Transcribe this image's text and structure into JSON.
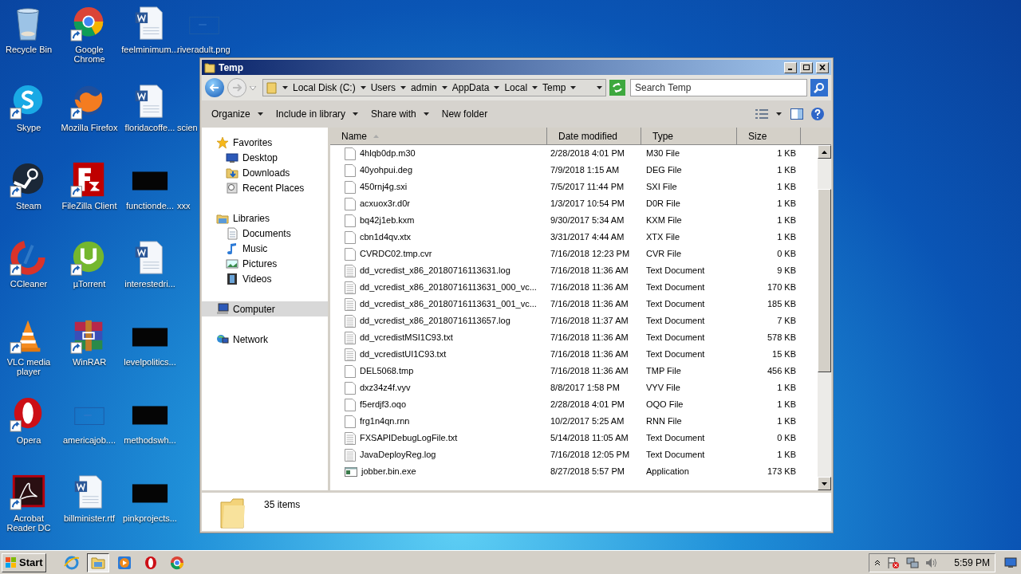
{
  "desktop": {
    "columns": [
      [
        {
          "label": "Recycle Bin",
          "kind": "recycle",
          "shortcut": false
        },
        {
          "label": "Skype",
          "kind": "skype",
          "shortcut": true
        },
        {
          "label": "Steam",
          "kind": "steam",
          "shortcut": true
        },
        {
          "label": "CCleaner",
          "kind": "ccleaner",
          "shortcut": true
        },
        {
          "label": "VLC media player",
          "kind": "vlc",
          "shortcut": true
        },
        {
          "label": "Opera",
          "kind": "opera",
          "shortcut": true
        },
        {
          "label": "Acrobat Reader DC",
          "kind": "acrobat",
          "shortcut": true
        }
      ],
      [
        {
          "label": "Google Chrome",
          "kind": "chrome",
          "shortcut": true
        },
        {
          "label": "Mozilla Firefox",
          "kind": "firefox",
          "shortcut": true
        },
        {
          "label": "FileZilla Client",
          "kind": "filezilla",
          "shortcut": true
        },
        {
          "label": "µTorrent",
          "kind": "utorrent",
          "shortcut": true
        },
        {
          "label": "WinRAR",
          "kind": "winrar",
          "shortcut": true
        },
        {
          "label": "americajob....",
          "kind": "blank-image",
          "shortcut": false
        },
        {
          "label": "billminister.rtf",
          "kind": "word",
          "shortcut": false
        }
      ],
      [
        {
          "label": "feelminimum...",
          "kind": "word",
          "shortcut": false
        },
        {
          "label": "floridacoffe...",
          "kind": "word",
          "shortcut": false
        },
        {
          "label": "functionde...",
          "kind": "dark-thumbnail",
          "shortcut": false
        },
        {
          "label": "interestedri...",
          "kind": "word",
          "shortcut": false
        },
        {
          "label": "levelpolitics...",
          "kind": "dark-thumbnail",
          "shortcut": false
        },
        {
          "label": "methodswh...",
          "kind": "dark-thumbnail",
          "shortcut": false
        },
        {
          "label": "pinkprojects...",
          "kind": "dark-thumbnail",
          "shortcut": false
        }
      ],
      [
        {
          "label": "riveradult.png",
          "kind": "blank-image",
          "shortcut": false
        },
        {
          "label": "scien"
        },
        {
          "label": "xxx"
        }
      ]
    ]
  },
  "window": {
    "title": "Temp",
    "breadcrumb": [
      "Local Disk (C:)",
      "Users",
      "admin",
      "AppData",
      "Local",
      "Temp"
    ],
    "search": {
      "placeholder": "Search Temp"
    },
    "toolbar": [
      {
        "label": "Organize",
        "dropdown": true
      },
      {
        "label": "Include in library",
        "dropdown": true
      },
      {
        "label": "Share with",
        "dropdown": true
      },
      {
        "label": "New folder",
        "dropdown": false
      }
    ],
    "nav": [
      {
        "label": "Favorites",
        "selected": false,
        "children": [
          {
            "label": "Desktop",
            "selected": false
          },
          {
            "label": "Downloads",
            "selected": false
          },
          {
            "label": "Recent Places",
            "selected": false
          }
        ]
      },
      {
        "label": "Libraries",
        "selected": false,
        "children": [
          {
            "label": "Documents",
            "selected": false
          },
          {
            "label": "Music",
            "selected": false
          },
          {
            "label": "Pictures",
            "selected": false
          },
          {
            "label": "Videos",
            "selected": false
          }
        ]
      },
      {
        "label": "Computer",
        "selected": true
      },
      {
        "label": "Network",
        "selected": false
      }
    ],
    "columns": [
      {
        "label": "Name",
        "sorted": true
      },
      {
        "label": "Date modified",
        "sorted": false
      },
      {
        "label": "Type",
        "sorted": false
      },
      {
        "label": "Size",
        "sorted": false
      }
    ],
    "rows": [
      {
        "name": "4hlqb0dp.m30",
        "date": "2/28/2018 4:01 PM",
        "type": "M30 File",
        "size": "1 KB",
        "kind": "blank"
      },
      {
        "name": "40yohpui.deg",
        "date": "7/9/2018 1:15 AM",
        "type": "DEG File",
        "size": "1 KB",
        "kind": "blank"
      },
      {
        "name": "450rnj4g.sxi",
        "date": "7/5/2017 11:44 PM",
        "type": "SXI File",
        "size": "1 KB",
        "kind": "blank"
      },
      {
        "name": "acxuox3r.d0r",
        "date": "1/3/2017 10:54 PM",
        "type": "D0R File",
        "size": "1 KB",
        "kind": "blank"
      },
      {
        "name": "bq42j1eb.kxm",
        "date": "9/30/2017 5:34 AM",
        "type": "KXM File",
        "size": "1 KB",
        "kind": "blank"
      },
      {
        "name": "cbn1d4qv.xtx",
        "date": "3/31/2017 4:44 AM",
        "type": "XTX File",
        "size": "1 KB",
        "kind": "blank"
      },
      {
        "name": "CVRDC02.tmp.cvr",
        "date": "7/16/2018 12:23 PM",
        "type": "CVR File",
        "size": "0 KB",
        "kind": "blank"
      },
      {
        "name": "dd_vcredist_x86_20180716113631.log",
        "date": "7/16/2018 11:36 AM",
        "type": "Text Document",
        "size": "9 KB",
        "kind": "text"
      },
      {
        "name": "dd_vcredist_x86_20180716113631_000_vc...",
        "date": "7/16/2018 11:36 AM",
        "type": "Text Document",
        "size": "170 KB",
        "kind": "text"
      },
      {
        "name": "dd_vcredist_x86_20180716113631_001_vc...",
        "date": "7/16/2018 11:36 AM",
        "type": "Text Document",
        "size": "185 KB",
        "kind": "text"
      },
      {
        "name": "dd_vcredist_x86_20180716113657.log",
        "date": "7/16/2018 11:37 AM",
        "type": "Text Document",
        "size": "7 KB",
        "kind": "text"
      },
      {
        "name": "dd_vcredistMSI1C93.txt",
        "date": "7/16/2018 11:36 AM",
        "type": "Text Document",
        "size": "578 KB",
        "kind": "text"
      },
      {
        "name": "dd_vcredistUI1C93.txt",
        "date": "7/16/2018 11:36 AM",
        "type": "Text Document",
        "size": "15 KB",
        "kind": "text"
      },
      {
        "name": "DEL5068.tmp",
        "date": "7/16/2018 11:36 AM",
        "type": "TMP File",
        "size": "456 KB",
        "kind": "blank"
      },
      {
        "name": "dxz34z4f.vyv",
        "date": "8/8/2017 1:58 PM",
        "type": "VYV File",
        "size": "1 KB",
        "kind": "blank"
      },
      {
        "name": "f5erdjf3.oqo",
        "date": "2/28/2018 4:01 PM",
        "type": "OQO File",
        "size": "1 KB",
        "kind": "blank"
      },
      {
        "name": "frg1n4qn.rnn",
        "date": "10/2/2017 5:25 AM",
        "type": "RNN File",
        "size": "1 KB",
        "kind": "blank"
      },
      {
        "name": "FXSAPIDebugLogFile.txt",
        "date": "5/14/2018 11:05 AM",
        "type": "Text Document",
        "size": "0 KB",
        "kind": "text"
      },
      {
        "name": "JavaDeployReg.log",
        "date": "7/16/2018 12:05 PM",
        "type": "Text Document",
        "size": "1 KB",
        "kind": "text"
      },
      {
        "name": "jobber.bin.exe",
        "date": "8/27/2018 5:57 PM",
        "type": "Application",
        "size": "173 KB",
        "kind": "app"
      }
    ],
    "status": "35 items"
  },
  "taskbar": {
    "start": "Start",
    "apps": [
      {
        "kind": "ie",
        "active": false
      },
      {
        "kind": "explorer",
        "active": true
      },
      {
        "kind": "media",
        "active": false
      },
      {
        "kind": "opera",
        "active": false
      },
      {
        "kind": "chrome",
        "active": false
      }
    ],
    "clock": "5:59 PM"
  }
}
